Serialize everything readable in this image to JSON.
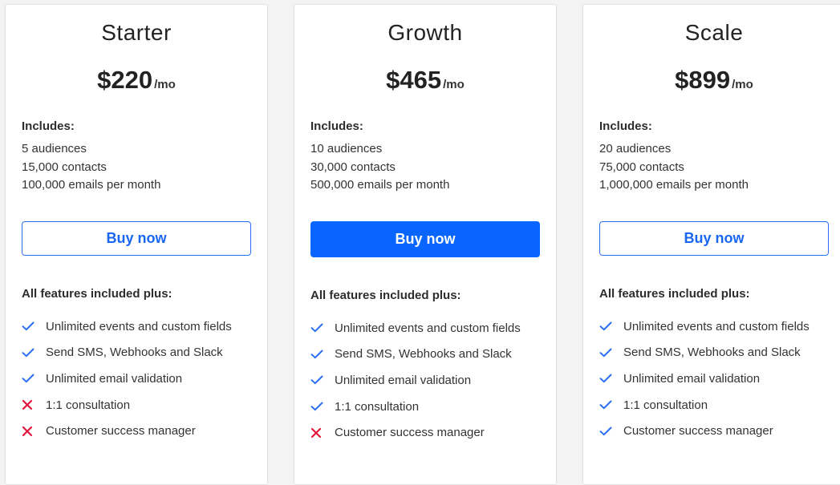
{
  "plans": [
    {
      "name": "Starter",
      "price": "$220",
      "period": "/mo",
      "includes_title": "Includes:",
      "includes": [
        "5 audiences",
        "15,000 contacts",
        "100,000 emails per month"
      ],
      "button_label": "Buy now",
      "features_title": "All features included plus:",
      "features": [
        {
          "label": "Unlimited events and custom fields",
          "icon": "check-icon"
        },
        {
          "label": "Send SMS, Webhooks and Slack",
          "icon": "check-icon"
        },
        {
          "label": "Unlimited email validation",
          "icon": "check-icon"
        },
        {
          "label": "1:1 consultation",
          "icon": "cross-icon"
        },
        {
          "label": "Customer success manager",
          "icon": "cross-icon"
        }
      ]
    },
    {
      "name": "Growth",
      "price": "$465",
      "period": "/mo",
      "includes_title": "Includes:",
      "includes": [
        "10 audiences",
        "30,000 contacts",
        "500,000 emails per month"
      ],
      "button_label": "Buy now",
      "features_title": "All features included plus:",
      "features": [
        {
          "label": "Unlimited events and custom fields",
          "icon": "check-icon"
        },
        {
          "label": "Send SMS, Webhooks and Slack",
          "icon": "check-icon"
        },
        {
          "label": "Unlimited email validation",
          "icon": "check-icon"
        },
        {
          "label": "1:1 consultation",
          "icon": "check-icon"
        },
        {
          "label": "Customer success manager",
          "icon": "cross-icon"
        }
      ]
    },
    {
      "name": "Scale",
      "price": "$899",
      "period": "/mo",
      "includes_title": "Includes:",
      "includes": [
        "20 audiences",
        "75,000 contacts",
        "1,000,000 emails per month"
      ],
      "button_label": "Buy now",
      "features_title": "All features included plus:",
      "features": [
        {
          "label": "Unlimited events and custom fields",
          "icon": "check-icon"
        },
        {
          "label": "Send SMS, Webhooks and Slack",
          "icon": "check-icon"
        },
        {
          "label": "Unlimited email validation",
          "icon": "check-icon"
        },
        {
          "label": "1:1 consultation",
          "icon": "check-icon"
        },
        {
          "label": "Customer success manager",
          "icon": "check-icon"
        }
      ]
    }
  ],
  "colors": {
    "accent": "#0866ff",
    "check": "#2a6df2",
    "cross": "#e0163c"
  }
}
